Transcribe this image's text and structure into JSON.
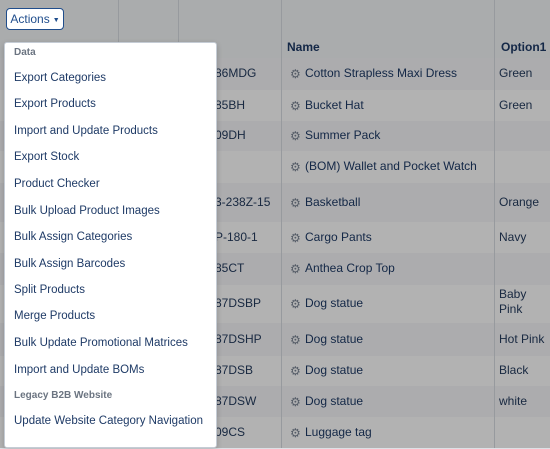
{
  "actions_button": {
    "label": "Actions"
  },
  "table": {
    "headers": {
      "name": "Name",
      "option1": "Option1"
    },
    "rows": [
      {
        "sku": "86MDG",
        "name": "Cotton Strapless Maxi Dress",
        "option1": "Green"
      },
      {
        "sku": "85BH",
        "name": "Bucket Hat",
        "option1": "Green"
      },
      {
        "sku": "09DH",
        "name": "Summer Pack",
        "option1": ""
      },
      {
        "sku": "",
        "name": "(BOM) Wallet and Pocket Watch",
        "option1": ""
      },
      {
        "sku": "3-238Z-15",
        "name": "Basketball",
        "option1": "Orange"
      },
      {
        "sku": "P-180-1",
        "name": "Cargo Pants",
        "option1": "Navy"
      },
      {
        "sku": "85CT",
        "name": "Anthea Crop Top",
        "option1": ""
      },
      {
        "sku": "87DSBP",
        "name": "Dog statue",
        "option1": "Baby Pink"
      },
      {
        "sku": "87DSHP",
        "name": "Dog statue",
        "option1": "Hot Pink"
      },
      {
        "sku": "87DSB",
        "name": "Dog statue",
        "option1": "Black"
      },
      {
        "sku": "87DSW",
        "name": "Dog statue",
        "option1": "white"
      },
      {
        "sku": "09CS",
        "name": "Luggage tag",
        "option1": ""
      }
    ]
  },
  "menu": {
    "section_data": "Data",
    "items": [
      "Export Categories",
      "Export Products",
      "Import and Update Products",
      "Export Stock",
      "Product Checker",
      "Bulk Upload Product Images",
      "Bulk Assign Categories",
      "Bulk Assign Barcodes",
      "Split Products",
      "Merge Products",
      "Bulk Update Promotional Matrices",
      "Import and Update BOMs"
    ],
    "section_legacy": "Legacy B2B Website",
    "legacy_items": [
      "Update Website Category Navigation"
    ]
  }
}
